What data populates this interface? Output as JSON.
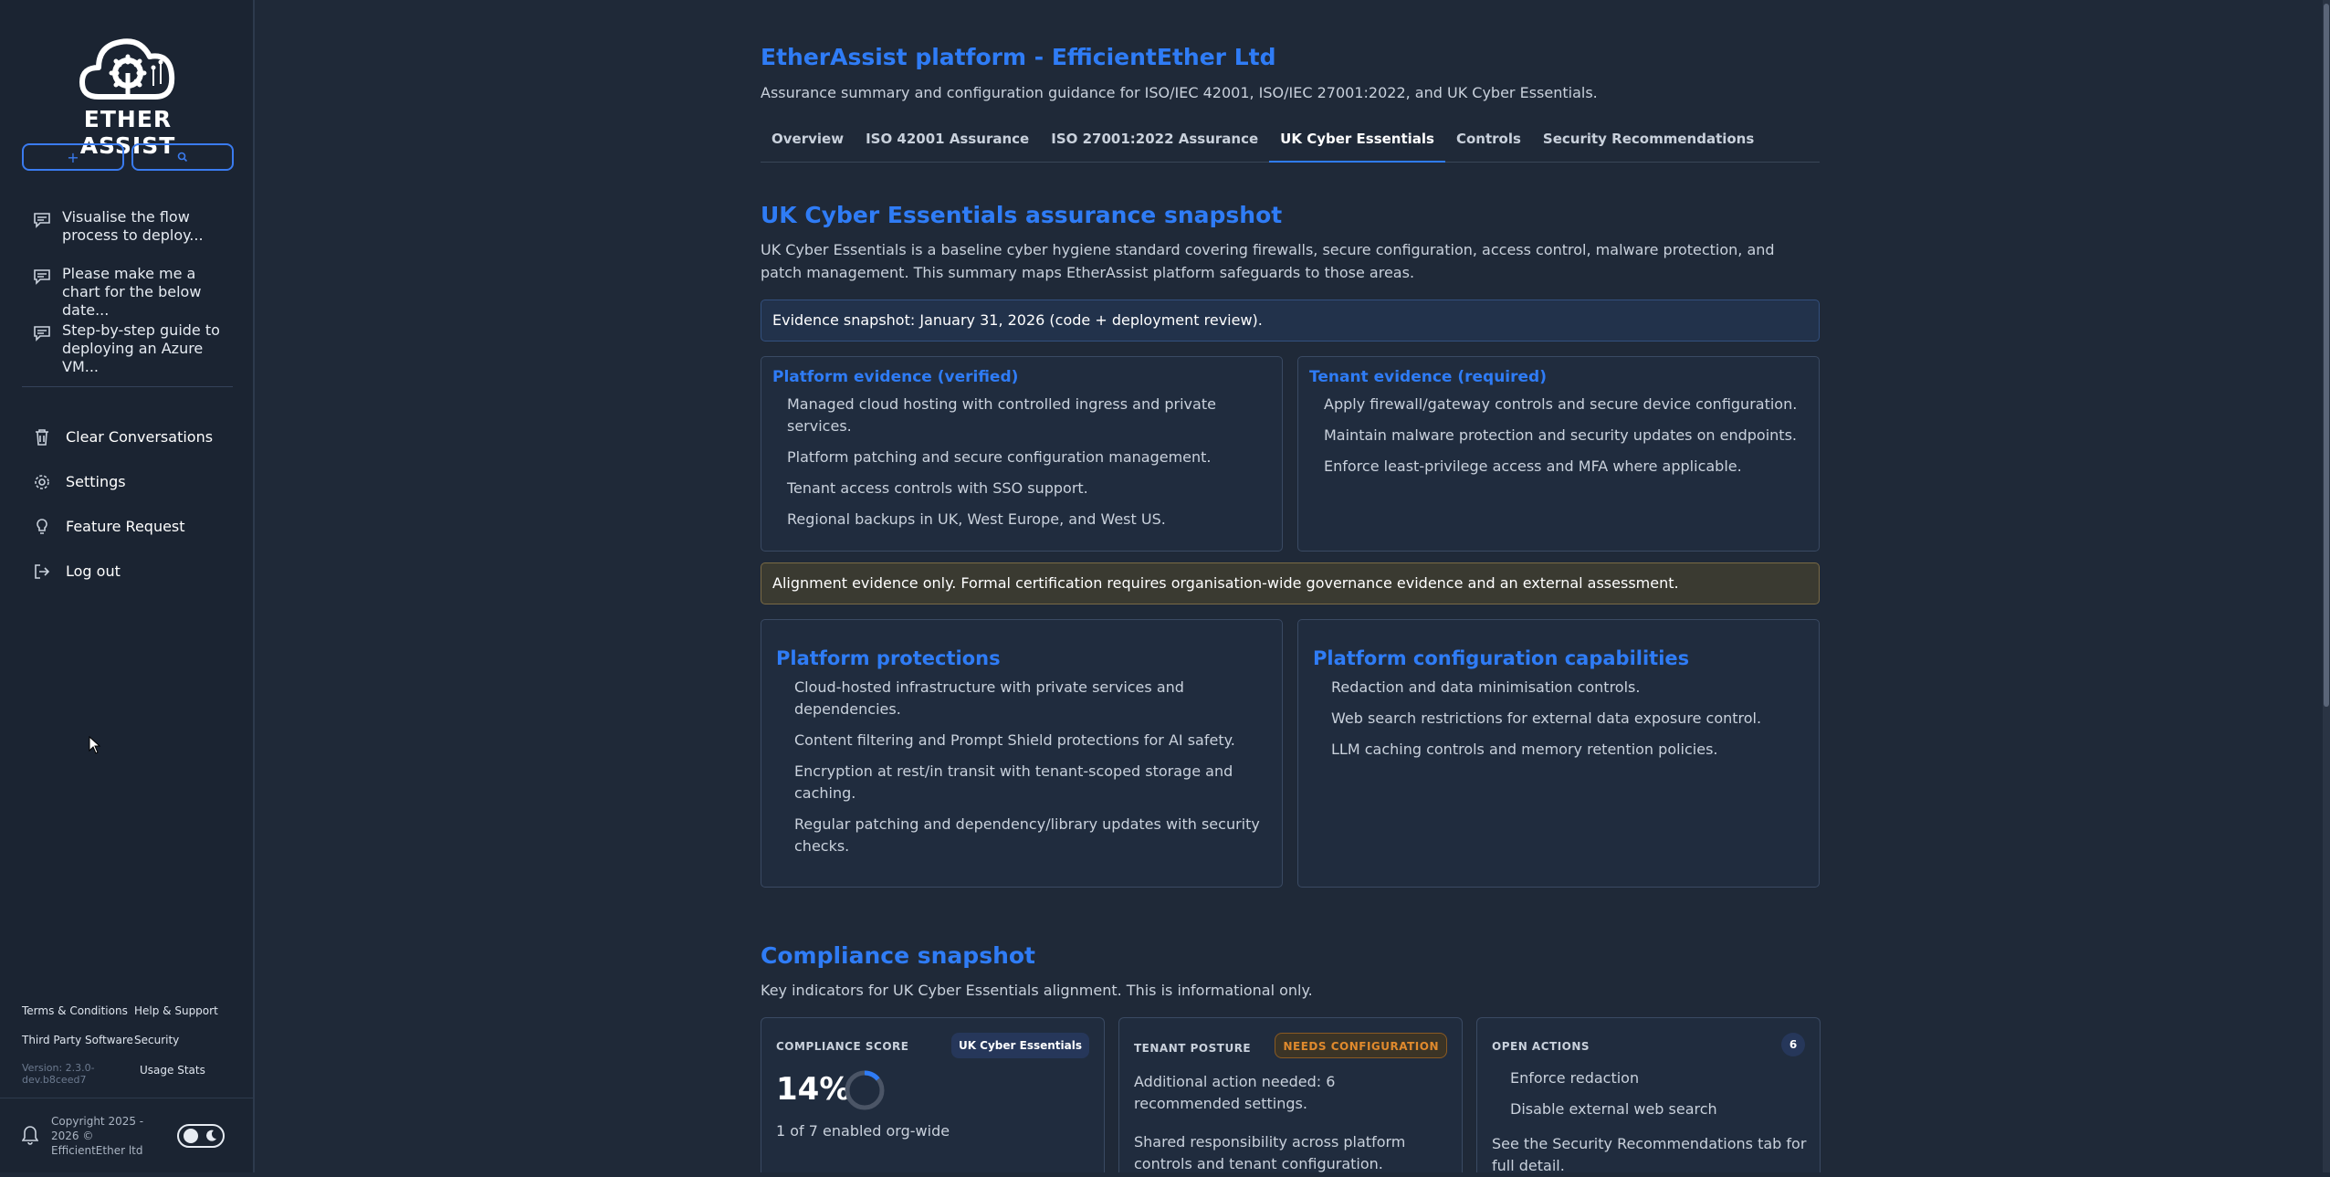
{
  "app": {
    "brand": "ETHER ASSIST",
    "new_chat_icon": "plus-icon",
    "search_icon": "search-icon"
  },
  "sidebar": {
    "conversations": [
      {
        "label": "Visualise the flow process to deploy..."
      },
      {
        "label": "Please make me a chart for the below date..."
      },
      {
        "label": "Step-by-step guide to deploying an Azure VM..."
      }
    ],
    "menu": [
      {
        "label": "Clear Conversations",
        "icon": "trash-icon"
      },
      {
        "label": "Settings",
        "icon": "gear-icon"
      },
      {
        "label": "Feature Request",
        "icon": "lightbulb-icon"
      },
      {
        "label": "Log out",
        "icon": "logout-icon"
      }
    ],
    "footer": {
      "terms": "Terms & Conditions",
      "help": "Help & Support",
      "third_party": "Third Party Software",
      "security": "Security",
      "version": "Version: 2.3.0-dev.b8ceed7",
      "usage": "Usage Stats",
      "copyright": "Copyright 2025 - 2026 © EfficientEther ltd"
    }
  },
  "main": {
    "title": "EtherAssist platform - EfficientEther Ltd",
    "subtitle": "Assurance summary and configuration guidance for ISO/IEC 42001, ISO/IEC 27001:2022, and UK Cyber Essentials.",
    "tabs": [
      {
        "label": "Overview"
      },
      {
        "label": "ISO 42001 Assurance"
      },
      {
        "label": "ISO 27001:2022 Assurance"
      },
      {
        "label": "UK Cyber Essentials",
        "active": true
      },
      {
        "label": "Controls"
      },
      {
        "label": "Security Recommendations"
      }
    ],
    "snapshot": {
      "title": "UK Cyber Essentials assurance snapshot",
      "description": "UK Cyber Essentials is a baseline cyber hygiene standard covering firewalls, secure configuration, access control, malware protection, and patch management. This summary maps EtherAssist platform safeguards to those areas.",
      "evidence_banner": "Evidence snapshot: January 31, 2026 (code + deployment review).",
      "platform_evidence": {
        "title": "Platform evidence (verified)",
        "items": [
          "Managed cloud hosting with controlled ingress and private services.",
          "Platform patching and secure configuration management.",
          "Tenant access controls with SSO support.",
          "Regional backups in UK, West Europe, and West US."
        ]
      },
      "tenant_evidence": {
        "title": "Tenant evidence (required)",
        "items": [
          "Apply firewall/gateway controls and secure device configuration.",
          "Maintain malware protection and security updates on endpoints.",
          "Enforce least-privilege access and MFA where applicable."
        ]
      },
      "warning": "Alignment evidence only. Formal certification requires organisation-wide governance evidence and an external assessment.",
      "platform_protections": {
        "title": "Platform protections",
        "items": [
          "Cloud-hosted infrastructure with private services and dependencies.",
          "Content filtering and Prompt Shield protections for AI safety.",
          "Encryption at rest/in transit with tenant-scoped storage and caching.",
          "Regular patching and dependency/library updates with security checks."
        ]
      },
      "config_capabilities": {
        "title": "Platform configuration capabilities",
        "items": [
          "Redaction and data minimisation controls.",
          "Web search restrictions for external data exposure control.",
          "LLM caching controls and memory retention policies."
        ]
      }
    },
    "compliance": {
      "title": "Compliance snapshot",
      "description": "Key indicators for UK Cyber Essentials alignment. This is informational only.",
      "score_card": {
        "label": "COMPLIANCE SCORE",
        "badge": "UK Cyber Essentials",
        "score": "14%",
        "score_fraction": 0.14,
        "detail": "1 of 7 enabled org-wide"
      },
      "posture_card": {
        "label": "TENANT POSTURE",
        "badge": "NEEDS CONFIGURATION",
        "text1": "Additional action needed: 6 recommended settings.",
        "text2": "Shared responsibility across platform controls and tenant configuration."
      },
      "actions_card": {
        "label": "OPEN ACTIONS",
        "count": "6",
        "items": [
          "Enforce redaction",
          "Disable external web search"
        ],
        "footer": "See the Security Recommendations tab for full detail."
      }
    }
  },
  "colors": {
    "accent": "#2f7cf6",
    "background": "#1f2938",
    "sidebar": "#1b2432",
    "warning": "#e08a2d"
  }
}
